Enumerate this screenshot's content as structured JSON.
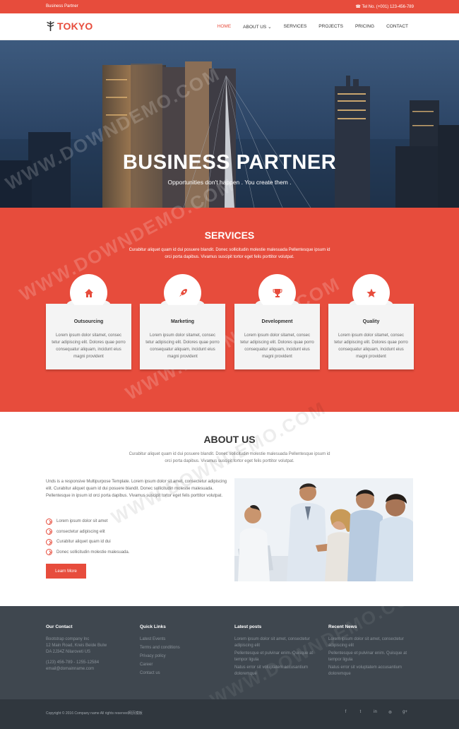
{
  "topbar": {
    "left": "Business Partner",
    "right": "☎ Tel No. (+001) 123-456-789"
  },
  "nav": {
    "logo": "TOKYO",
    "items": [
      {
        "label": "HOME",
        "active": true
      },
      {
        "label": "ABOUT US ⌄",
        "active": false
      },
      {
        "label": "SERVICES",
        "active": false
      },
      {
        "label": "PROJECTS",
        "active": false
      },
      {
        "label": "PRICING",
        "active": false
      },
      {
        "label": "CONTACT",
        "active": false
      }
    ]
  },
  "hero": {
    "title": "BUSINESS PARTNER",
    "subtitle": "Opportunities don't happen . You create them ."
  },
  "services": {
    "title": "SERVICES",
    "desc": "Curabitur aliquet quam id dui posuere blandit. Donec sollicitudin molestie malesuada Pellentesque ipsum id orci porta dapibus. Vivamus suscipit tortor eget felis porttitor volutpat.",
    "cards": [
      {
        "icon": "home-icon",
        "name": "Outsourcing",
        "text": "Lorem ipsum dolor sitamet, consec tetur adipiscing elit. Dolores quae porro consequatur aliquam, incidunt eius magni provident"
      },
      {
        "icon": "rocket-icon",
        "name": "Marketing",
        "text": "Lorem ipsum dolor sitamet, consec tetur adipiscing elit. Dolores quae porro consequatur aliquam, incidunt eius magni provident"
      },
      {
        "icon": "trophy-icon",
        "name": "Development",
        "text": "Lorem ipsum dolor sitamet, consec tetur adipiscing elit. Dolores quae porro consequatur aliquam, incidunt eius magni provident"
      },
      {
        "icon": "star-icon",
        "name": "Quality",
        "text": "Lorem ipsum dolor sitamet, consec tetur adipiscing elit. Dolores quae porro consequatur aliquam, incidunt eius magni provident"
      }
    ]
  },
  "about": {
    "title": "ABOUT US",
    "desc": "Curabitur aliquet quam id dui posuere blandit. Donec sollicitudin molestie malesuada Pellentesque ipsum id orci porta dapibus. Vivamus suscipit tortor eget felis porttitor volutpat.",
    "para": "Unds is a responsive Multipurpose Template. Lorem ipsum dolor sit amet, consectetur adipiscing elit. Curabitur aliquet quam id dui posuere blandit. Donec sollicitudin molestie malesuada. Pellentesque in ipsum id orci porta dapibus. Vivamus suscipit tortor eget felis porttitor volutpat.",
    "list": [
      "Lorem ipsum dolor sit amet",
      "consectetur adipiscing elit",
      "Curabitur aliquet quam id dui",
      "Donec sollicitudin molestie malesuada."
    ],
    "button": "Learn More"
  },
  "footer": {
    "contact": {
      "title": "Our Contact",
      "lines": [
        "Bootstrap company Inc",
        "12 Main Road, Kreis Beide Bulw",
        "DA 2J34Z Nilaroveti US"
      ],
      "phone": "(123) 456-789 - 1255-12584",
      "email": "email@domainname.com"
    },
    "links": {
      "title": "Quick Links",
      "items": [
        "Latest Events",
        "Terms and conditions",
        "Privacy policy",
        "Career",
        "Contact us"
      ]
    },
    "latest": {
      "title": "Latest posts",
      "items": [
        "Lorem ipsum dolor sit amet, consectetur adipiscing elit",
        "Pellentesque et pulvinar enim. Quisque at tempor ligula",
        "Natus error sit voluptatem accusantium doloremque"
      ]
    },
    "recent": {
      "title": "Recent News",
      "items": [
        "Lorem ipsum dolor sit amet, consectetur adipiscing elit",
        "Pellentesque et pulvinar enim. Quisque at tempor ligula",
        "Natus error sit voluptatem accusantium doloremque"
      ]
    },
    "copyright": "Copyright © 2016 Company name All rights reserved网页模板",
    "social": [
      "f",
      "t",
      "in",
      "⊚",
      "g+"
    ]
  },
  "watermark": "WWW.DOWNDEMO.COM",
  "colors": {
    "accent": "#e74c3c",
    "footer_bg": "#3f474f",
    "bottom_bg": "#30373e"
  }
}
